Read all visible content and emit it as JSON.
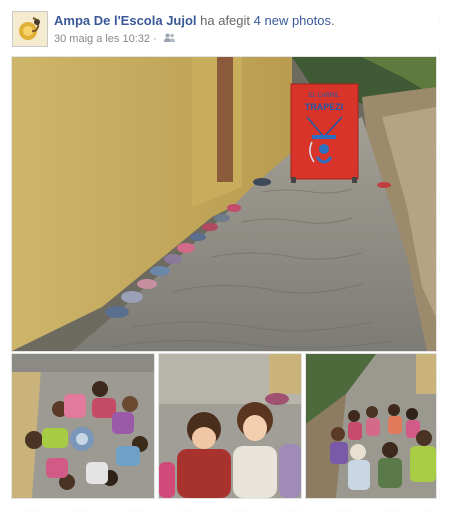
{
  "post": {
    "poster_name": "Ampa De l'Escola Jujol",
    "action_text": " ha afegit ",
    "photos_link": "4 new photos",
    "period": ".",
    "timestamp": "30 maig a les 10:32",
    "separator": " · ",
    "privacy_icon": "friends-icon"
  },
  "photos": {
    "main": {
      "sign_line1": "EL CARRIL",
      "sign_line2": "TRAPEZI"
    }
  },
  "colors": {
    "link": "#3b5998",
    "meta": "#888888",
    "wall": "#d8c27a",
    "ground": "#8e8e88",
    "sign": "#d9342a"
  }
}
